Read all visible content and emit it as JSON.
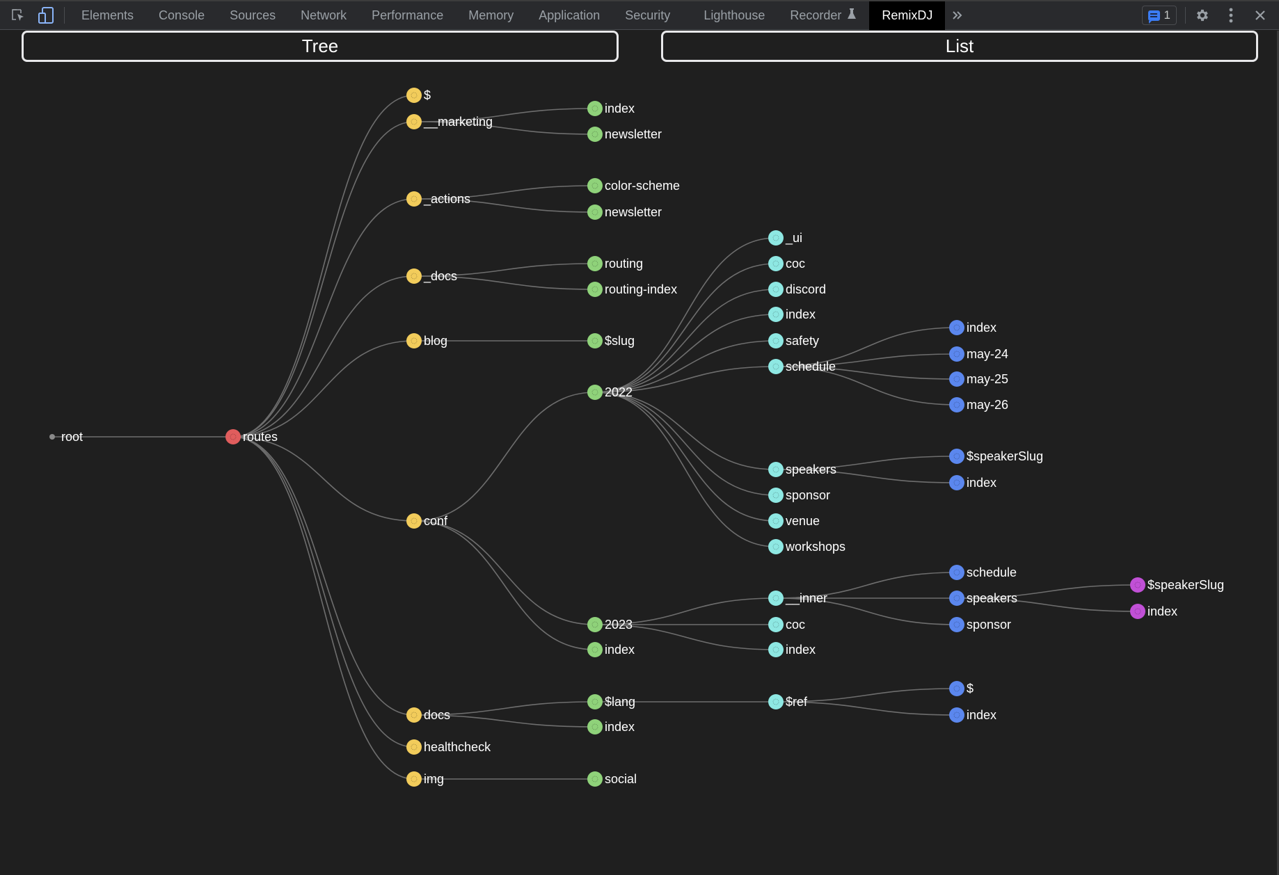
{
  "toolbar": {
    "tabs": [
      {
        "label": "Elements"
      },
      {
        "label": "Console"
      },
      {
        "label": "Sources"
      },
      {
        "label": "Network"
      },
      {
        "label": "Performance"
      },
      {
        "label": "Memory"
      },
      {
        "label": "Application"
      },
      {
        "label": "Security"
      },
      {
        "label": "Lighthouse"
      },
      {
        "label": "Recorder"
      },
      {
        "label": "RemixDJ"
      }
    ],
    "active_tab": "RemixDJ",
    "issues_count": "1",
    "icons": {
      "inspect": "inspect-element-icon",
      "device": "device-toolbar-icon",
      "recorder_badge": "flask-icon",
      "more_tabs": "chevron-double-right-icon",
      "issues": "message-icon",
      "settings": "gear-icon",
      "menu": "kebab-menu-icon",
      "close": "close-icon"
    }
  },
  "views": {
    "tree_label": "Tree",
    "list_label": "List"
  },
  "colors": {
    "root": "#8a8a8a",
    "level1": "#e05d5d",
    "level2": "#f2cc5b",
    "level3": "#8fd27a",
    "level4": "#8ee8e3",
    "level5": "#5b87ee",
    "level6": "#c150d6",
    "link": "#6e6e6e"
  },
  "tree": {
    "name": "root",
    "children": [
      {
        "name": "routes",
        "children": [
          {
            "name": "$"
          },
          {
            "name": "__marketing",
            "children": [
              {
                "name": "index"
              },
              {
                "name": "newsletter"
              }
            ]
          },
          {
            "name": "_actions",
            "children": [
              {
                "name": "color-scheme"
              },
              {
                "name": "newsletter"
              }
            ]
          },
          {
            "name": "_docs",
            "children": [
              {
                "name": "routing"
              },
              {
                "name": "routing-index"
              }
            ]
          },
          {
            "name": "blog",
            "children": [
              {
                "name": "$slug"
              }
            ]
          },
          {
            "name": "conf",
            "children": [
              {
                "name": "2022",
                "children": [
                  {
                    "name": "_ui"
                  },
                  {
                    "name": "coc"
                  },
                  {
                    "name": "discord"
                  },
                  {
                    "name": "index"
                  },
                  {
                    "name": "safety"
                  },
                  {
                    "name": "schedule",
                    "children": [
                      {
                        "name": "index"
                      },
                      {
                        "name": "may-24"
                      },
                      {
                        "name": "may-25"
                      },
                      {
                        "name": "may-26"
                      }
                    ]
                  },
                  {
                    "name": "speakers",
                    "children": [
                      {
                        "name": "$speakerSlug"
                      },
                      {
                        "name": "index"
                      }
                    ]
                  },
                  {
                    "name": "sponsor"
                  },
                  {
                    "name": "venue"
                  },
                  {
                    "name": "workshops"
                  }
                ]
              },
              {
                "name": "2023",
                "children": [
                  {
                    "name": "__inner",
                    "children": [
                      {
                        "name": "schedule"
                      },
                      {
                        "name": "speakers",
                        "children": [
                          {
                            "name": "$speakerSlug"
                          },
                          {
                            "name": "index"
                          }
                        ]
                      },
                      {
                        "name": "sponsor"
                      }
                    ]
                  },
                  {
                    "name": "coc"
                  },
                  {
                    "name": "index"
                  }
                ]
              },
              {
                "name": "index"
              }
            ]
          },
          {
            "name": "docs",
            "children": [
              {
                "name": "$lang",
                "children": [
                  {
                    "name": "$ref",
                    "children": [
                      {
                        "name": "$"
                      },
                      {
                        "name": "index"
                      }
                    ]
                  }
                ]
              },
              {
                "name": "index"
              }
            ]
          },
          {
            "name": "healthcheck"
          },
          {
            "name": "img",
            "children": [
              {
                "name": "social"
              }
            ]
          }
        ]
      }
    ]
  }
}
